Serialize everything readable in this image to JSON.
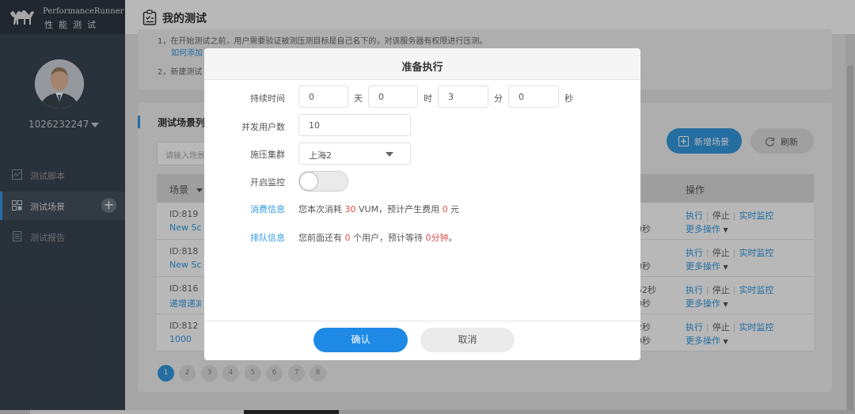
{
  "logo": {
    "title_en": "PerformanceRunner",
    "title_cn": "性能测试"
  },
  "user": {
    "name": "1026232247"
  },
  "sidebar": {
    "items": [
      {
        "label": "测试脚本",
        "icon": "chart-icon"
      },
      {
        "label": "测试场景",
        "icon": "grid-icon"
      },
      {
        "label": "测试报告",
        "icon": "document-icon"
      }
    ]
  },
  "header": {
    "title": "我的测试",
    "icon": "clipboard-check-icon"
  },
  "tips": {
    "line1": "1，在开始测试之前，用户需要验证被测压测目标是自己名下的，对该服务器有权限进行压测。",
    "link1": "如何添加",
    "line2": "2，新建测试"
  },
  "list": {
    "title": "测试场景列",
    "search_placeholder": "请输入场景",
    "new_button": "新增场景",
    "refresh_button": "刷新",
    "col_scene": "场景",
    "col_ops": "操作",
    "rows": [
      {
        "id": "ID:819",
        "name": "New Sce",
        "d1": "",
        "d2": "0秒"
      },
      {
        "id": "ID:818",
        "name": "New Sce",
        "d1": "",
        "d2": "0秒"
      },
      {
        "id": "ID:816",
        "name": "递增递减",
        "d1": "52秒",
        "d2": "0秒"
      },
      {
        "id": "ID:812",
        "name": "1000",
        "d1": "2秒",
        "d2": "0秒"
      }
    ],
    "op_run": "执行",
    "op_stop": "停止",
    "op_monitor": "实时监控",
    "op_more": "更多操作"
  },
  "pagination": [
    "1",
    "2",
    "3",
    "4",
    "5",
    "6",
    "7",
    "8"
  ],
  "modal": {
    "title": "准备执行",
    "duration_label": "持续时间",
    "days": "0",
    "days_unit": "天",
    "hours": "0",
    "hours_unit": "时",
    "minutes": "3",
    "minutes_unit": "分",
    "seconds": "0",
    "seconds_unit": "秒",
    "users_label": "并发用户数",
    "users": "10",
    "cluster_label": "施压集群",
    "cluster": "上海2",
    "monitor_label": "开启监控",
    "monitor_on": false,
    "cost_label": "消费信息",
    "cost_pre": "您本次消耗 ",
    "cost_vum": "30",
    "cost_mid": " VUM，预计产生费用 ",
    "cost_fee": "0",
    "cost_post": " 元",
    "queue_label": "排队信息",
    "queue_pre": "您前面还有 ",
    "queue_count": "0",
    "queue_mid": " 个用户，预计等待 ",
    "queue_wait": "0分钟",
    "queue_post": "。",
    "confirm": "确认",
    "cancel": "取消"
  },
  "colors": {
    "accent": "#3399e0",
    "sidebar": "#3a4452",
    "warning": "#e24c4c"
  }
}
